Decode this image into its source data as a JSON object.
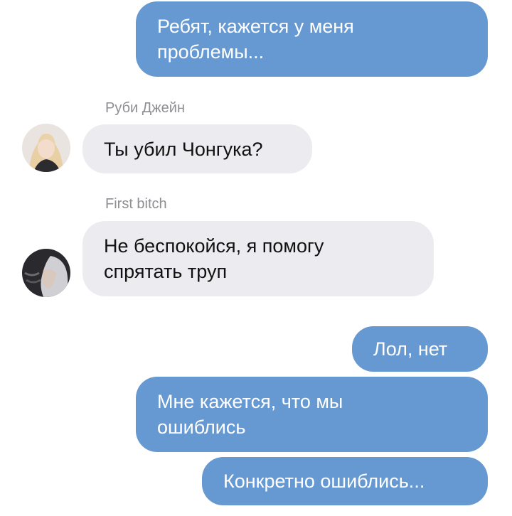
{
  "messages": {
    "m1": {
      "text": "Ребят, кажется у меня\nпроблемы..."
    },
    "m2": {
      "sender": "Руби Джейн",
      "text": "Ты убил Чонгука?"
    },
    "m3": {
      "sender": "First bitch",
      "text": "Не беспокойся, я помогу\nспрятать труп"
    },
    "m4": {
      "text": "Лол, нет"
    },
    "m5": {
      "text": "Мне кажется, что мы\nошиблись"
    },
    "m6": {
      "text": "Конкретно ошиблись..."
    }
  },
  "colors": {
    "outgoing_bubble": "#6699d1",
    "incoming_bubble": "#ececf0",
    "sender_name": "#8e8e93"
  }
}
